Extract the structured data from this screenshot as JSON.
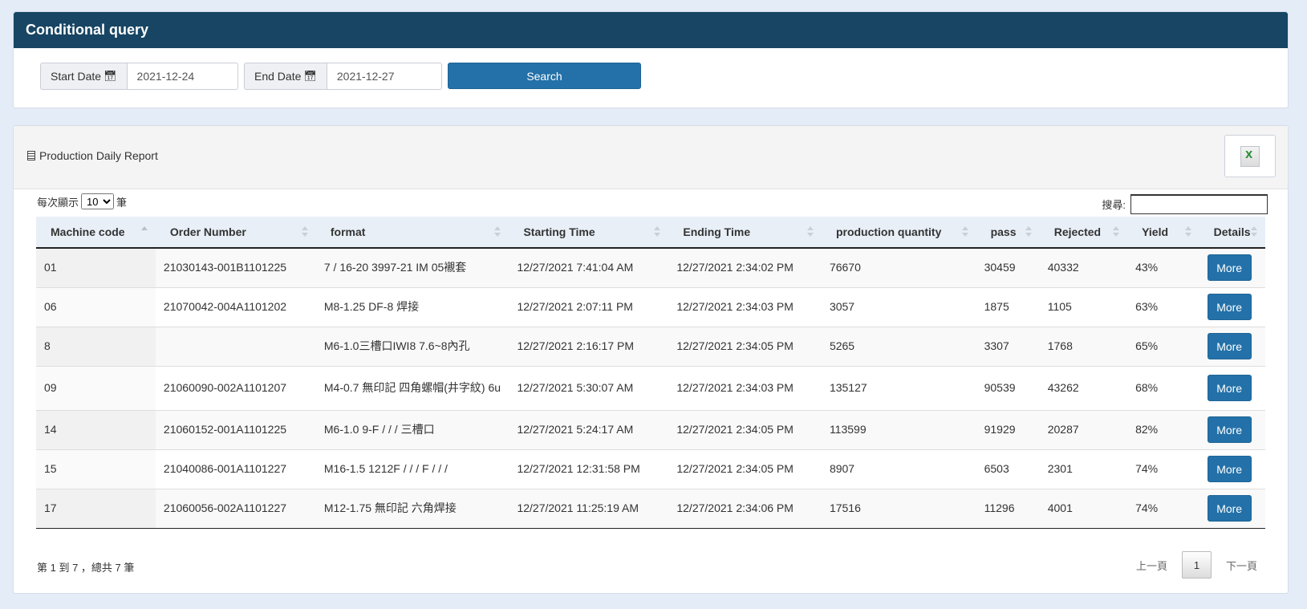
{
  "query": {
    "title": "Conditional query",
    "start_label": "Start Date",
    "start_value": "2021-12-24",
    "end_label": "End Date",
    "end_value": "2021-12-27",
    "search_label": "Search"
  },
  "report": {
    "title": "Production Daily Report",
    "excel_icon": "excel-icon",
    "length_prefix": "每次顯示",
    "length_value": "10",
    "length_options": [
      "10"
    ],
    "length_suffix": "筆",
    "search_label": "搜尋:",
    "search_value": ""
  },
  "table": {
    "columns": [
      "Machine code",
      "Order Number",
      "format",
      "Starting Time",
      "Ending Time",
      "production quantity",
      "pass",
      "Rejected",
      "Yield",
      "Details"
    ],
    "rows": [
      {
        "machine": "01",
        "order": "21030143-001B1101225",
        "format": "7 / 16-20 3997-21 IM 05襯套",
        "start": "12/27/2021 7:41:04 AM",
        "end": "12/27/2021 2:34:02 PM",
        "qty": "76670",
        "pass": "30459",
        "rejected": "40332",
        "yield": "43%",
        "details": "More"
      },
      {
        "machine": "06",
        "order": "21070042-004A1101202",
        "format": "M8-1.25 DF-8 焊接",
        "start": "12/27/2021 2:07:11 PM",
        "end": "12/27/2021 2:34:03 PM",
        "qty": "3057",
        "pass": "1875",
        "rejected": "1105",
        "yield": "63%",
        "details": "More"
      },
      {
        "machine": "8",
        "order": "",
        "format": "M6-1.0三槽口IWI8 7.6~8內孔",
        "start": "12/27/2021 2:16:17 PM",
        "end": "12/27/2021 2:34:05 PM",
        "qty": "5265",
        "pass": "3307",
        "rejected": "1768",
        "yield": "65%",
        "details": "More"
      },
      {
        "machine": "09",
        "order": "21060090-002A1101207",
        "format": "M4-0.7 無印記 四角螺帽(井字紋) 6u",
        "start": "12/27/2021 5:30:07 AM",
        "end": "12/27/2021 2:34:03 PM",
        "qty": "135127",
        "pass": "90539",
        "rejected": "43262",
        "yield": "68%",
        "details": "More"
      },
      {
        "machine": "14",
        "order": "21060152-001A1101225",
        "format": "M6-1.0 9-F / / / 三槽口",
        "start": "12/27/2021 5:24:17 AM",
        "end": "12/27/2021 2:34:05 PM",
        "qty": "113599",
        "pass": "91929",
        "rejected": "20287",
        "yield": "82%",
        "details": "More"
      },
      {
        "machine": "15",
        "order": "21040086-001A1101227",
        "format": "M16-1.5 1212F / / / F / / /",
        "start": "12/27/2021 12:31:58 PM",
        "end": "12/27/2021 2:34:05 PM",
        "qty": "8907",
        "pass": "6503",
        "rejected": "2301",
        "yield": "74%",
        "details": "More"
      },
      {
        "machine": "17",
        "order": "21060056-002A1101227",
        "format": "M12-1.75 無印記 六角焊接",
        "start": "12/27/2021 11:25:19 AM",
        "end": "12/27/2021 2:34:06 PM",
        "qty": "17516",
        "pass": "11296",
        "rejected": "4001",
        "yield": "74%",
        "details": "More"
      }
    ]
  },
  "footer": {
    "info": "第 1 到 7 ，總共 7 筆",
    "prev": "上一頁",
    "page": "1",
    "next": "下一頁"
  }
}
